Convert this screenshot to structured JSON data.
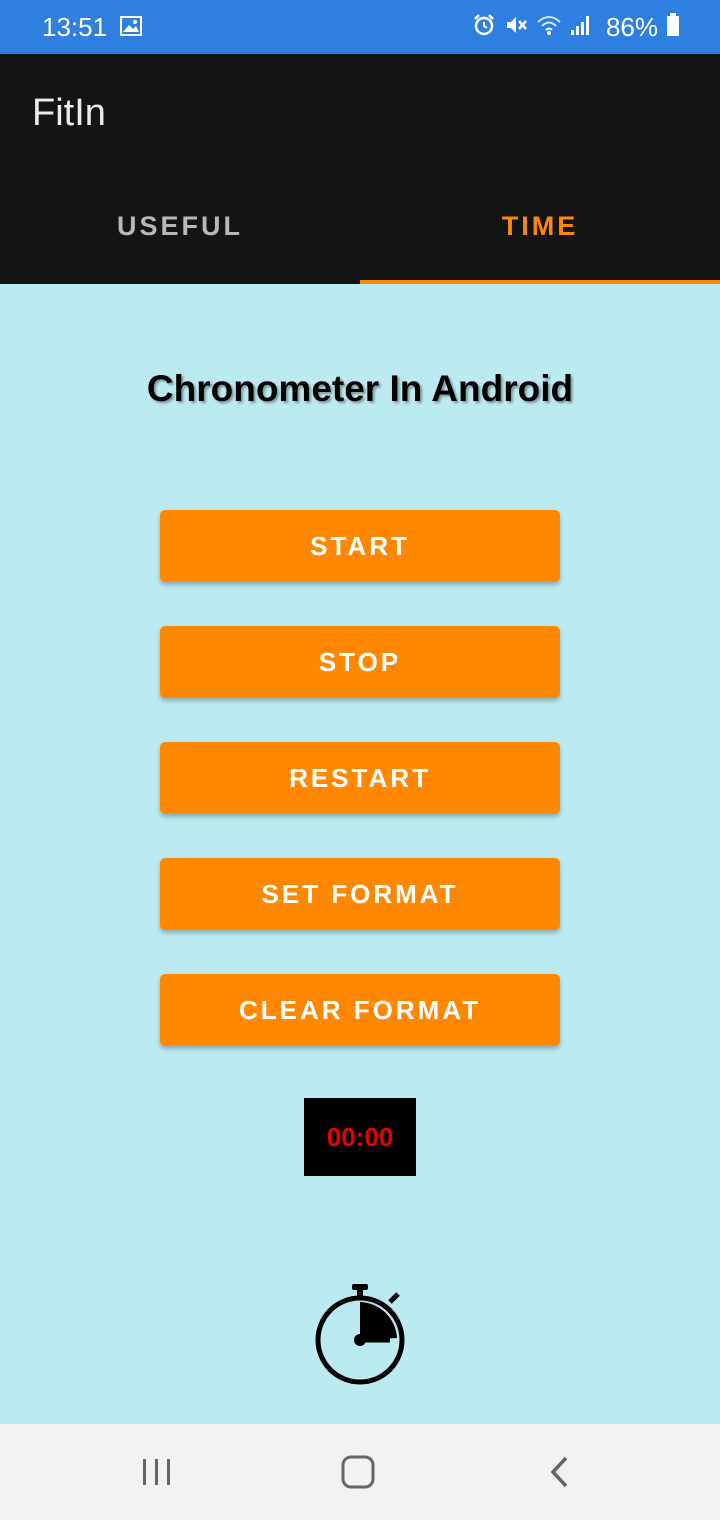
{
  "status_bar": {
    "time": "13:51",
    "battery": "86%",
    "icons": [
      "image-icon",
      "alarm-icon",
      "mute-icon",
      "wifi-icon",
      "signal-icon",
      "battery-icon"
    ]
  },
  "app": {
    "title": "FitIn"
  },
  "tabs": [
    {
      "label": "USEFUL",
      "selected": false
    },
    {
      "label": "TIME",
      "selected": true
    }
  ],
  "main": {
    "heading": "Chronometer In Android",
    "buttons": {
      "start": "START",
      "stop": "STOP",
      "restart": "RESTART",
      "set_format": "SET FORMAT",
      "clear_format": "CLEAR FORMAT"
    },
    "chronometer": "00:00",
    "decor_icon": "stopwatch-icon"
  },
  "nav_bar": {
    "icons": [
      "recents-icon",
      "home-icon",
      "back-icon"
    ]
  },
  "colors": {
    "status_bar": "#2e7fe0",
    "app_bar": "#141414",
    "accent": "#ff8800",
    "background": "#bbeaf0",
    "chrono_text": "#e60000"
  }
}
